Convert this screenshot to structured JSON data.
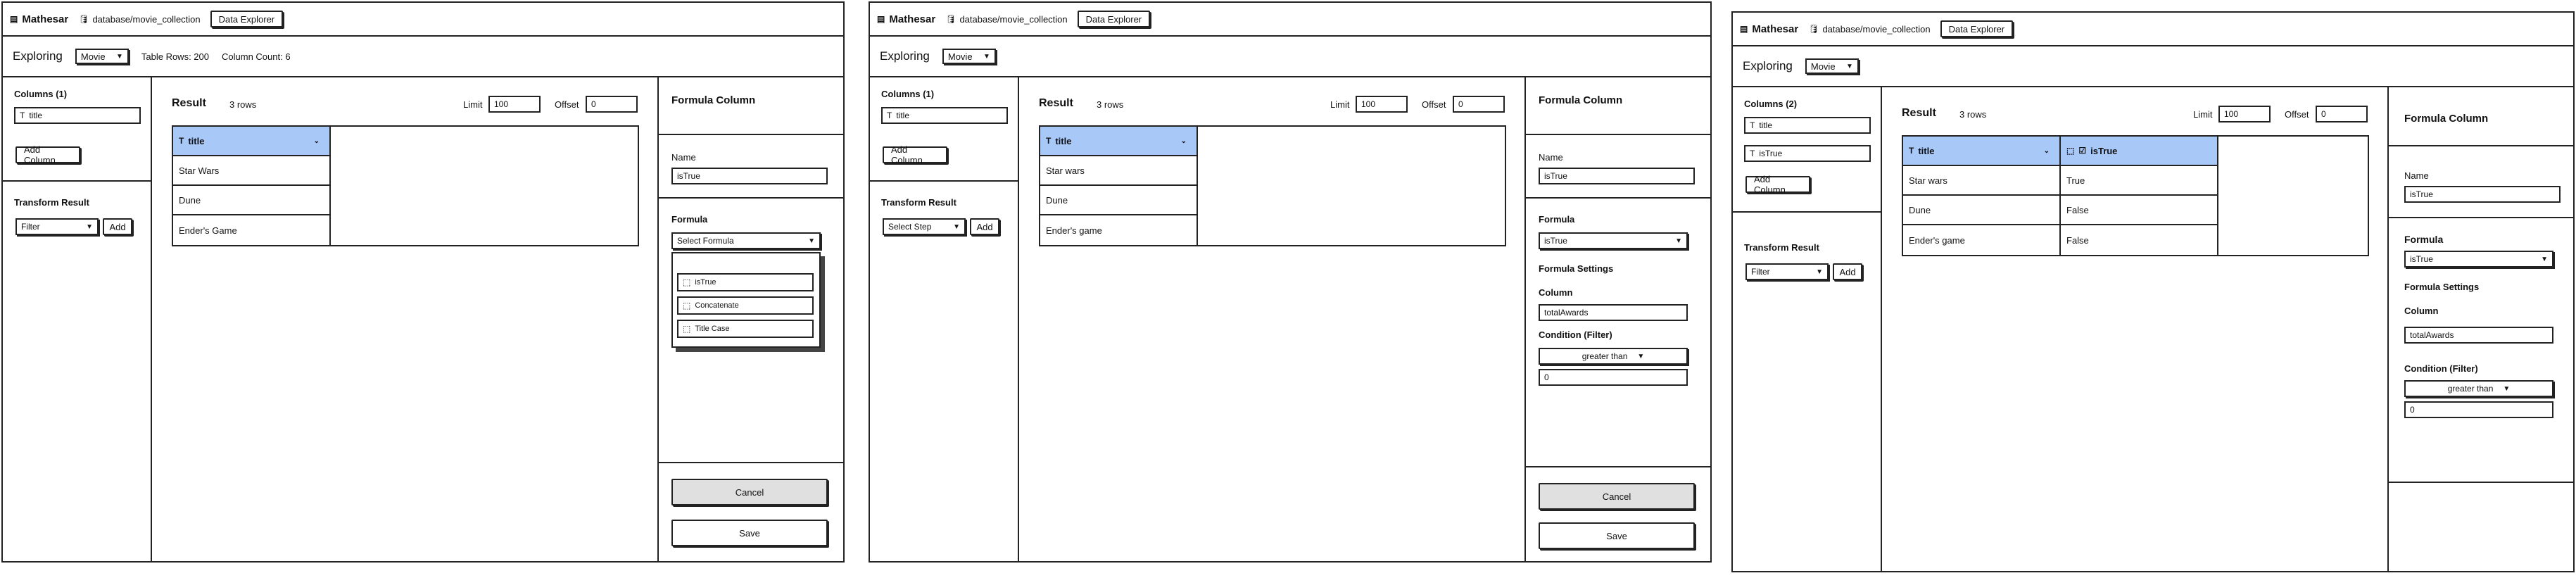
{
  "app": {
    "name": "Mathesar",
    "breadcrumb": "database/movie_collection",
    "explorer_button": "Data Explorer",
    "exploring_label": "Exploring",
    "table_select": "Movie"
  },
  "screens": [
    {
      "meta": {
        "table_rows": "Table Rows: 200",
        "column_count": "Column Count: 6"
      },
      "columns_header": "Columns (1)",
      "column_items": [
        "title"
      ],
      "add_column": "Add Column",
      "transform_header": "Transform Result",
      "transform_select": "Filter",
      "add_button": "Add",
      "result_title": "Result",
      "rows_count": "3 rows",
      "limit_label": "Limit",
      "limit_value": "100",
      "offset_label": "Offset",
      "offset_value": "0",
      "grid_headers": [
        "title"
      ],
      "grid_rows": [
        [
          "Star Wars"
        ],
        [
          "Dune"
        ],
        [
          "Ender's Game"
        ]
      ],
      "formula_title": "Formula Column",
      "name_label": "Name",
      "name_value": "isTrue",
      "formula_label": "Formula",
      "formula_select": "Select Formula",
      "formula_options": [
        "isTrue",
        "Concatenate",
        "Title Case"
      ],
      "cancel": "Cancel",
      "save": "Save"
    },
    {
      "columns_header": "Columns (1)",
      "column_items": [
        "title"
      ],
      "add_column": "Add Column",
      "transform_header": "Transform Result",
      "transform_select": "Select Step",
      "add_button": "Add",
      "result_title": "Result",
      "rows_count": "3 rows",
      "limit_label": "Limit",
      "limit_value": "100",
      "offset_label": "Offset",
      "offset_value": "0",
      "grid_headers": [
        "title"
      ],
      "grid_rows": [
        [
          "Star wars"
        ],
        [
          "Dune"
        ],
        [
          "Ender's game"
        ]
      ],
      "formula_title": "Formula Column",
      "name_label": "Name",
      "name_value": "isTrue",
      "formula_label": "Formula",
      "formula_select": "isTrue",
      "settings_label": "Formula Settings",
      "column_label": "Column",
      "column_value": "totalAwards",
      "condition_label": "Condition (Filter)",
      "condition_select": "greater than",
      "condition_value": "0",
      "cancel": "Cancel",
      "save": "Save"
    },
    {
      "columns_header": "Columns (2)",
      "column_items": [
        "title",
        "isTrue"
      ],
      "add_column": "Add Column",
      "transform_header": "Transform Result",
      "transform_select": "Filter",
      "add_button": "Add",
      "result_title": "Result",
      "rows_count": "3 rows",
      "limit_label": "Limit",
      "limit_value": "100",
      "offset_label": "Offset",
      "offset_value": "0",
      "grid_headers": [
        "title",
        "isTrue"
      ],
      "grid_rows": [
        [
          "Star wars",
          "True"
        ],
        [
          "Dune",
          "False"
        ],
        [
          "Ender's game",
          "False"
        ]
      ],
      "formula_title": "Formula Column",
      "name_label": "Name",
      "name_value": "isTrue",
      "formula_label": "Formula",
      "formula_select": "isTrue",
      "settings_label": "Formula Settings",
      "column_label": "Column",
      "column_value": "totalAwards",
      "condition_label": "Condition (Filter)",
      "condition_select": "greater than",
      "condition_value": "0"
    }
  ]
}
